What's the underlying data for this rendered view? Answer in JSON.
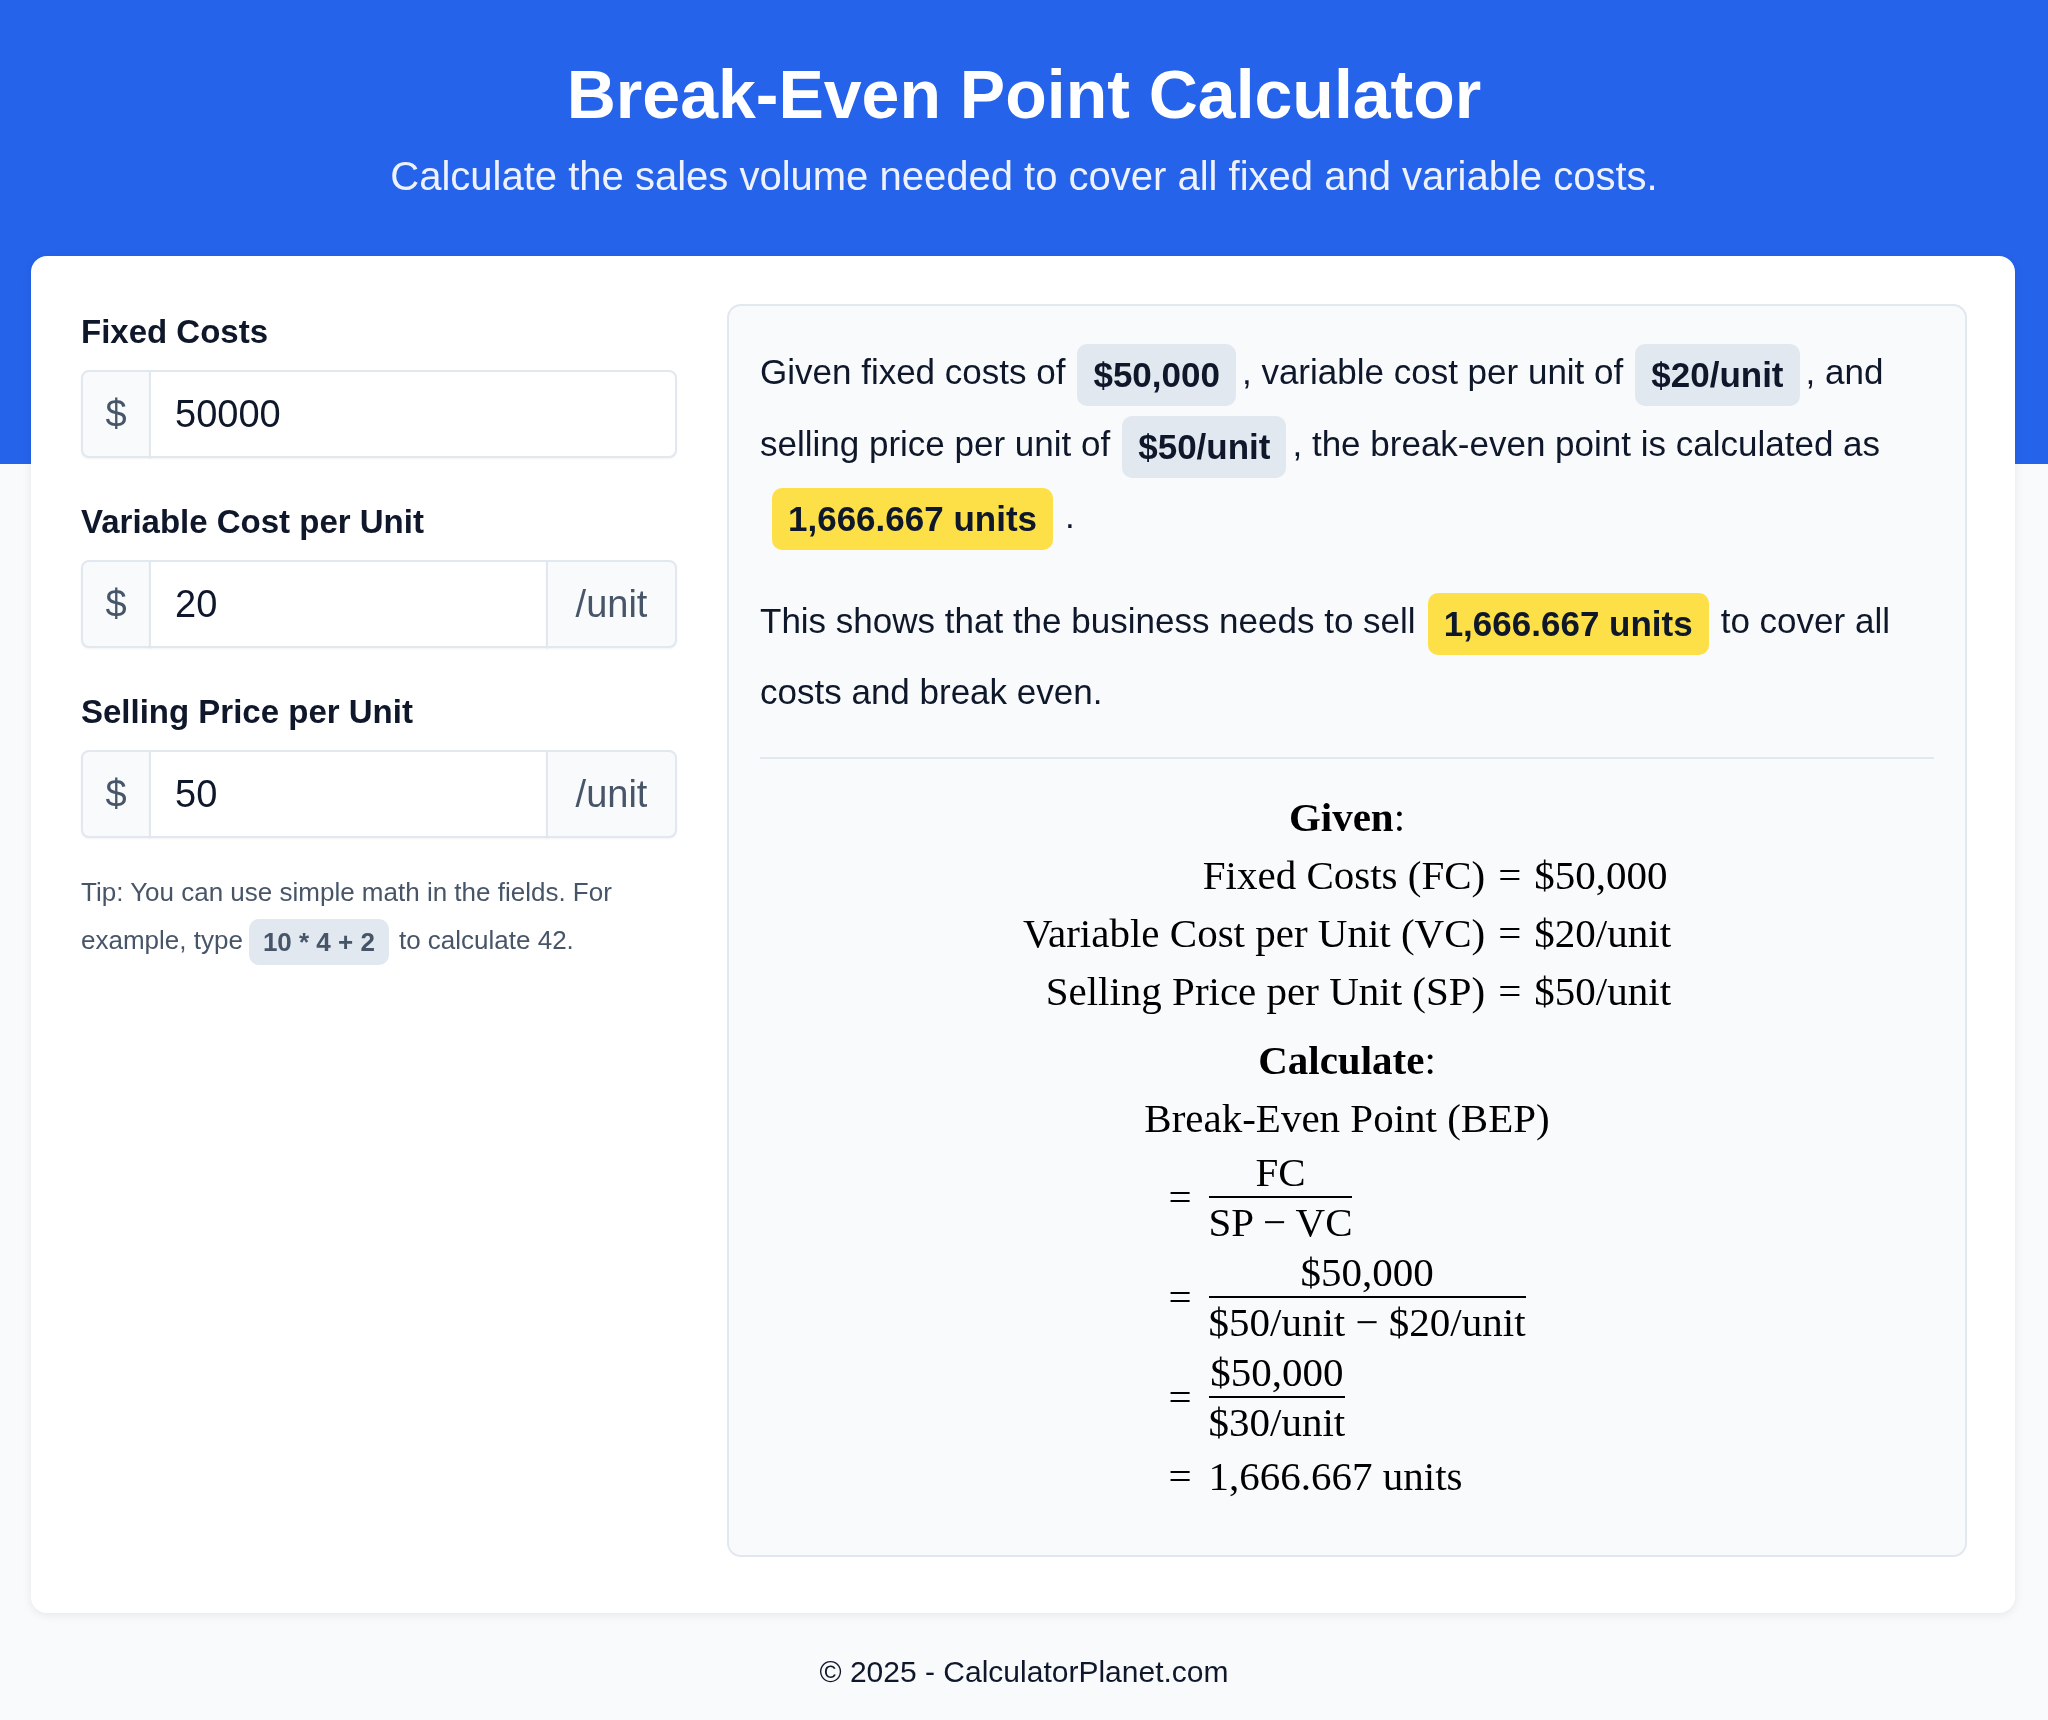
{
  "header": {
    "title": "Break-Even Point Calculator",
    "subtitle": "Calculate the sales volume needed to cover all fixed and variable costs."
  },
  "form": {
    "fields": [
      {
        "label": "Fixed Costs",
        "prefix": "$",
        "value": "50000"
      },
      {
        "label": "Variable Cost per Unit",
        "prefix": "$",
        "value": "20",
        "suffix": "/unit"
      },
      {
        "label": "Selling Price per Unit",
        "prefix": "$",
        "value": "50",
        "suffix": "/unit"
      }
    ],
    "tip": [
      {
        "kind": "text",
        "text": "Tip: You can use simple math in the fields. For"
      },
      {
        "kind": "text",
        "text": "example, type"
      },
      {
        "kind": "code",
        "text": "10 * 4 + 2"
      },
      {
        "kind": "text",
        "text": "to calculate 42."
      }
    ]
  },
  "result": {
    "paragraphs": [
      [
        {
          "kind": "text",
          "text": "Given fixed costs of"
        },
        {
          "kind": "chip",
          "text": "$50,000"
        },
        {
          "kind": "text",
          "text": ", variable cost per unit of"
        },
        {
          "kind": "chip",
          "text": "$20/unit"
        },
        {
          "kind": "text",
          "text": ", and"
        },
        {
          "kind": "text",
          "text": "selling price per unit of"
        },
        {
          "kind": "chip",
          "text": "$50/unit"
        },
        {
          "kind": "text",
          "text": ", the break-even point is calculated as"
        },
        {
          "kind": "highlight",
          "text": "1,666.667 units"
        },
        {
          "kind": "text",
          "text": "."
        }
      ],
      [
        {
          "kind": "text",
          "text": "This shows that the business needs to sell"
        },
        {
          "kind": "highlight",
          "text": "1,666.667 units"
        },
        {
          "kind": "text",
          "text": "to cover all"
        },
        {
          "kind": "text",
          "text": "costs and break even."
        }
      ]
    ],
    "given": {
      "heading": "**Given**:",
      "rows": [
        {
          "term": "Fixed Costs (FC)",
          "op": "=",
          "value": "$50,000"
        },
        {
          "term": "Variable Cost per Unit (VC)",
          "op": "=",
          "value": "$20/unit"
        },
        {
          "term": "Selling Price per Unit (SP)",
          "op": "=",
          "value": "$50/unit"
        }
      ]
    },
    "calculate": {
      "heading": "**Calculate**:",
      "term": "Break-Even Point (BEP)",
      "steps": [
        {
          "kind": "fraction",
          "op": "=",
          "numerator": "FC",
          "denominator": "SP − VC"
        },
        {
          "kind": "fraction",
          "op": "=",
          "numerator": "$50,000",
          "denominator": "$50/unit − $20/unit"
        },
        {
          "kind": "fraction",
          "op": "=",
          "numerator": "$50,000",
          "denominator": "$30/unit"
        },
        {
          "kind": "value",
          "op": "=",
          "value": "1,666.667 units"
        }
      ]
    }
  },
  "footer": {
    "text": "© 2025 - CalculatorPlanet.com"
  }
}
